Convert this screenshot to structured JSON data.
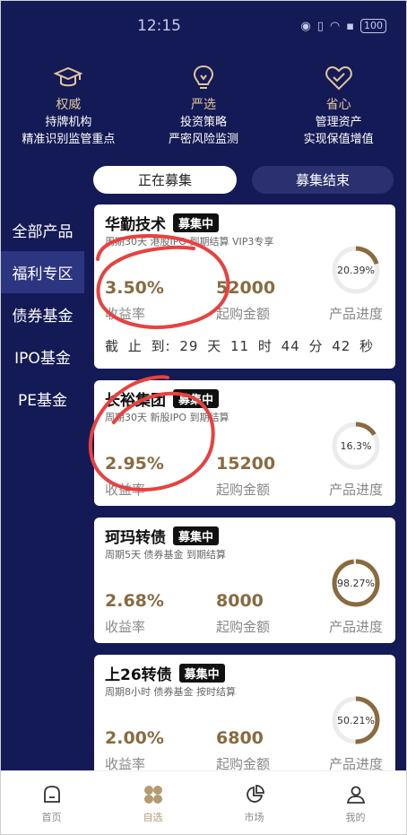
{
  "status_bar": {
    "time": "12:15",
    "battery": "100"
  },
  "features": [
    {
      "icon": "graduation-cap-icon",
      "title": "权威",
      "line1": "持牌机构",
      "line2": "精准识别监管重点"
    },
    {
      "icon": "lightbulb-icon",
      "title": "严选",
      "line1": "投资策略",
      "line2": "严密风险监测"
    },
    {
      "icon": "heart-check-icon",
      "title": "省心",
      "line1": "管理资产",
      "line2": "实现保值增值"
    }
  ],
  "tabs": {
    "active": "正在募集",
    "inactive": "募集结束"
  },
  "side_menu": [
    "全部产品",
    "福利专区",
    "债券基金",
    "IPO基金",
    "PE基金"
  ],
  "labels": {
    "rate": "收益率",
    "min_amount": "起购金额",
    "progress": "产品进度",
    "deadline_prefix": "截 止 到:"
  },
  "products": [
    {
      "name": "华勤技术",
      "badge": "募集中",
      "desc": "周期30天 港股IPO 到期结算 VIP3专享",
      "rate": "3.50%",
      "min": "52000",
      "progress": "20.39%",
      "progress_value": 20.39,
      "deadline": "29 天 11 时 44 分 42 秒"
    },
    {
      "name": "长裕集团",
      "badge": "募集中",
      "desc": "周期30天 新股IPO 到期结算",
      "rate": "2.95%",
      "min": "15200",
      "progress": "16.3%",
      "progress_value": 16.3
    },
    {
      "name": "珂玛转债",
      "badge": "募集中",
      "desc": "周期5天 债券基金 到期结算",
      "rate": "2.68%",
      "min": "8000",
      "progress": "98.27%",
      "progress_value": 98.27
    },
    {
      "name": "上26转债",
      "badge": "募集中",
      "desc": "周期8小时 债券基金 按时结算",
      "rate": "2.00%",
      "min": "6800",
      "progress": "50.21%",
      "progress_value": 50.21
    }
  ],
  "bottom_nav": [
    {
      "label": "首页",
      "icon": "home-icon"
    },
    {
      "label": "自选",
      "icon": "grid-icon"
    },
    {
      "label": "市场",
      "icon": "pie-chart-icon"
    },
    {
      "label": "我的",
      "icon": "user-icon"
    }
  ],
  "colors": {
    "background": "#141a55",
    "accent_gold": "#8a6a3f",
    "ring": "#8a6a3f",
    "scribble": "#e8413f"
  }
}
